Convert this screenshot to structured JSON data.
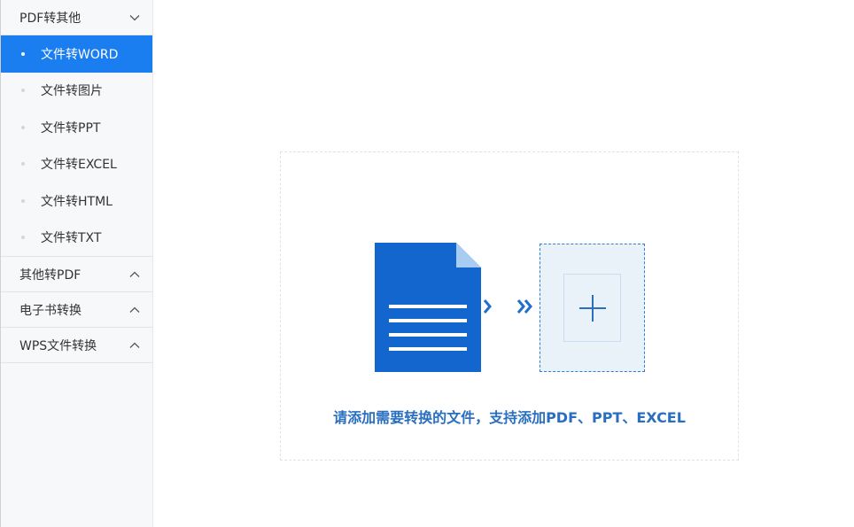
{
  "sidebar": {
    "groups": [
      {
        "label": "PDF转其他",
        "expanded": true,
        "items": [
          {
            "label": "文件转WORD",
            "active": true
          },
          {
            "label": "文件转图片",
            "active": false
          },
          {
            "label": "文件转PPT",
            "active": false
          },
          {
            "label": "文件转EXCEL",
            "active": false
          },
          {
            "label": "文件转HTML",
            "active": false
          },
          {
            "label": "文件转TXT",
            "active": false
          }
        ]
      },
      {
        "label": "其他转PDF",
        "expanded": false
      },
      {
        "label": "电子书转换",
        "expanded": false
      },
      {
        "label": "WPS文件转换",
        "expanded": false
      }
    ]
  },
  "main": {
    "dropzone": {
      "hint": "请添加需要转换的文件，支持添加PDF、PPT、EXCEL",
      "source_icon": "document-icon",
      "arrow_icon": "double-chevron-right-icon",
      "add_icon": "plus-icon"
    }
  },
  "colors": {
    "accent": "#1a7ef0",
    "doc_blue": "#1466cf",
    "hint_blue": "#2a6fbf"
  }
}
